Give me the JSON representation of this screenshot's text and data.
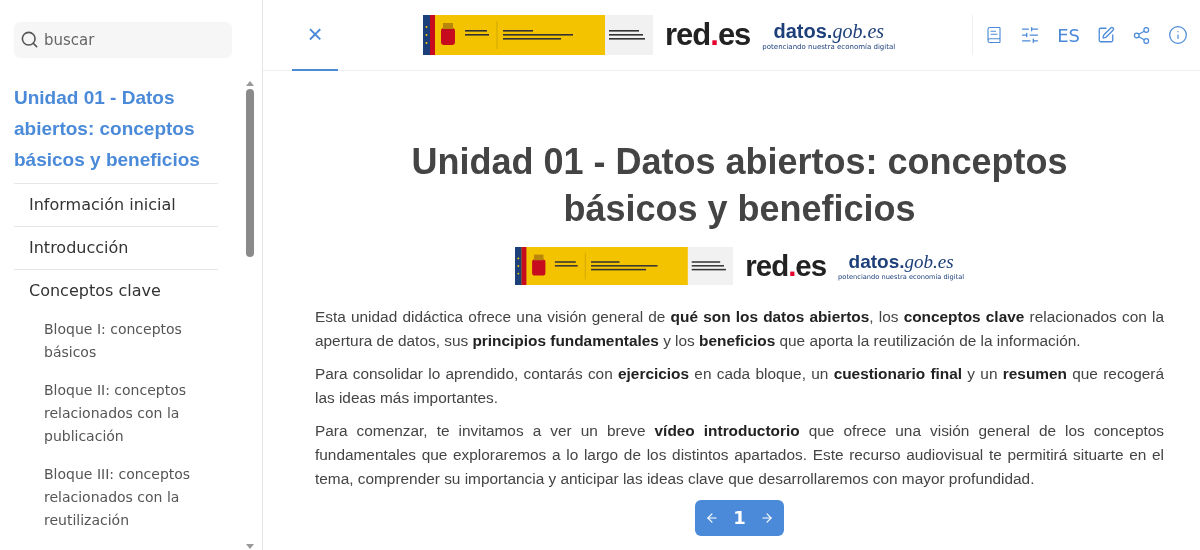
{
  "search": {
    "placeholder": "buscar"
  },
  "toc": {
    "title": "Unidad 01 - Datos abiertos: conceptos básicos y beneficios",
    "selected": true,
    "items": [
      {
        "label": "Información inicial",
        "selected": false
      },
      {
        "label": "Introducción",
        "selected": false
      },
      {
        "label": "Conceptos clave",
        "selected": false,
        "children": [
          {
            "label": "Bloque I: conceptos básicos",
            "selected": false
          },
          {
            "label": "Bloque II: conceptos relacionados con la publicación",
            "selected": false
          },
          {
            "label": "Bloque III: conceptos relacionados con la reutilización",
            "selected": false
          }
        ]
      }
    ]
  },
  "header": {
    "close": "×",
    "logos": {
      "red": [
        "red",
        ".",
        "es"
      ],
      "datos": [
        "datos.",
        "gob.es",
        "potenciando nuestra economía digital"
      ]
    },
    "language": "ES"
  },
  "content": {
    "title": "Unidad 01 - Datos abiertos: conceptos básicos y beneficios",
    "logos": {
      "red": [
        "red",
        ".",
        "es"
      ],
      "datos": [
        "datos.",
        "gob.es",
        "potenciando nuestra economía digital"
      ]
    },
    "paragraphs": [
      "Esta unidad didáctica ofrece una visión general de **qué son los datos abiertos**, los **conceptos clave** relacionados con la apertura de datos, sus **principios fundamentales** y los **beneficios** que aporta la reutilización de la información.",
      "Para consolidar lo aprendido, contarás con **ejercicios** en cada bloque, un **cuestionario final** y un **resumen** que recogerá las ideas más importantes.",
      "Para comenzar, te invitamos a ver un breve **vídeo introductorio** que ofrece una visión general de los conceptos fundamentales que exploraremos a lo largo de los distintos apartados. Este recurso audiovisual te permitirá situarte en el tema, comprender su importancia y anticipar las ideas clave que desarrollaremos con mayor profundidad."
    ]
  },
  "pager": {
    "page": "1"
  }
}
